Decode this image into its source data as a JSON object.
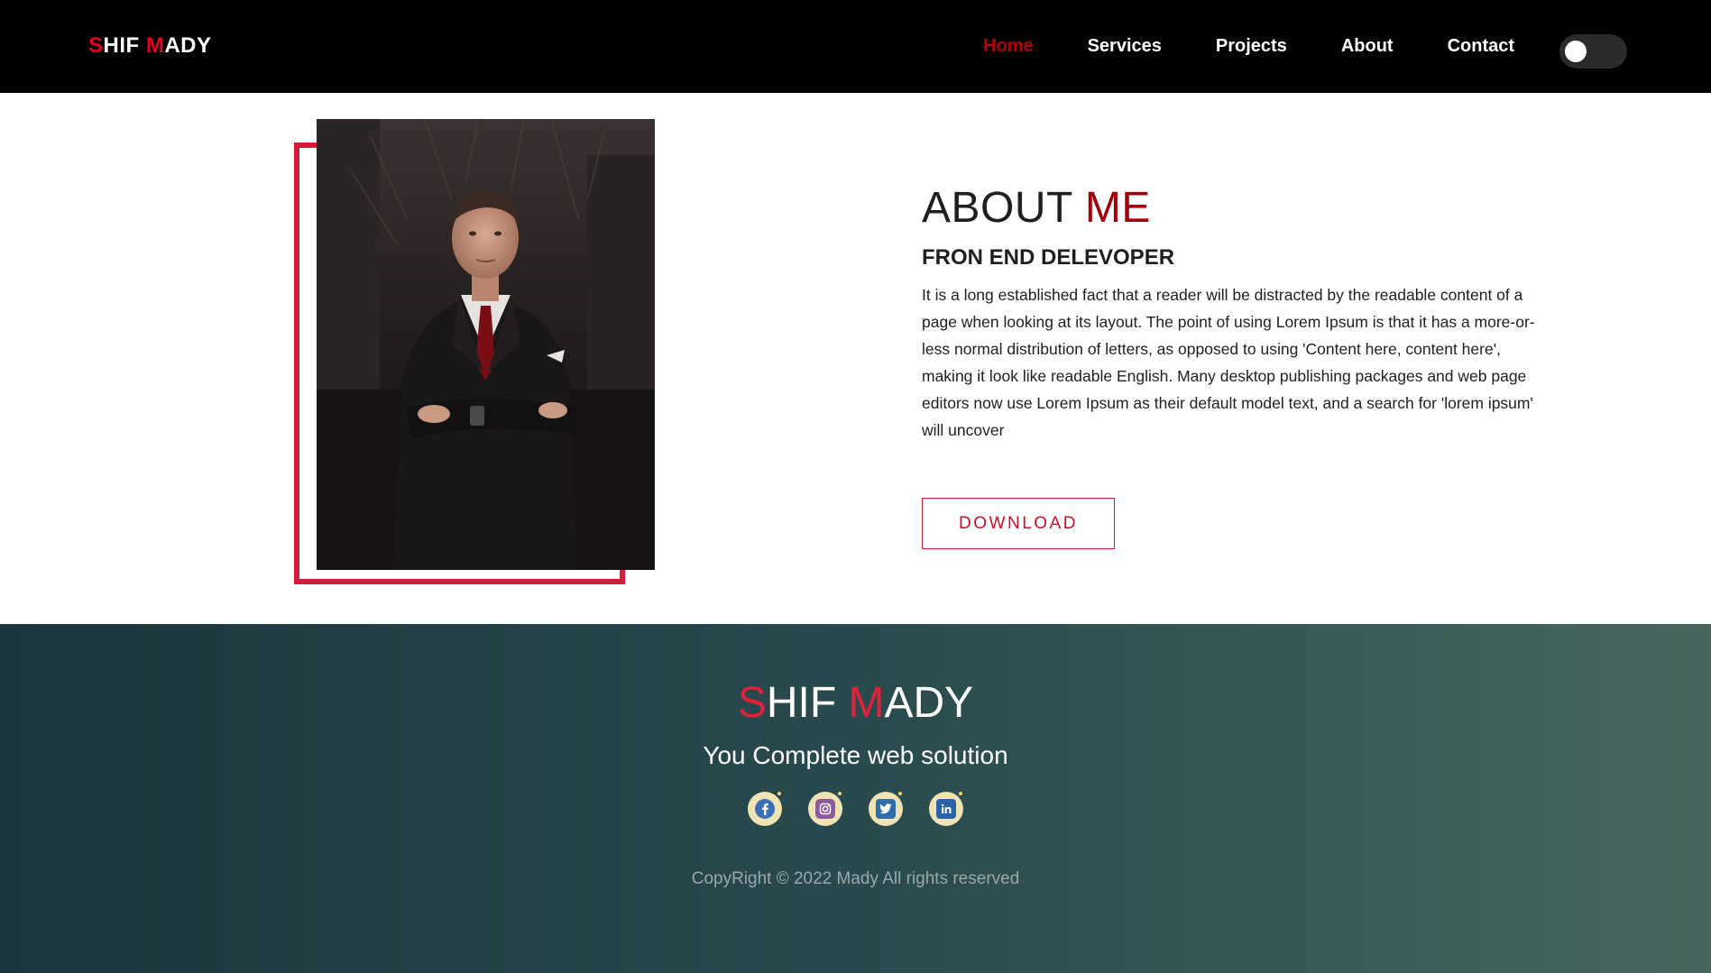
{
  "navbar": {
    "logo_first_initial": "S",
    "logo_first_rest": "HIF ",
    "logo_second_initial": "M",
    "logo_second_rest": "ADY",
    "links": [
      {
        "label": "Home",
        "active": true
      },
      {
        "label": "Services",
        "active": false
      },
      {
        "label": "Projects",
        "active": false
      },
      {
        "label": "About",
        "active": false
      },
      {
        "label": "Contact",
        "active": false
      }
    ],
    "theme_toggle_state": "off"
  },
  "about": {
    "title_main": "ABOUT ",
    "title_accent": "ME",
    "subtitle": "FRON END DELEVOPER",
    "description": "It is a long established fact that a reader will be distracted by the readable content of a page when looking at its layout. The point of using Lorem Ipsum is that it has a more-or-less normal distribution of letters, as opposed to using 'Content here, content here', making it look like readable English. Many desktop publishing packages and web page editors now use Lorem Ipsum as their default model text, and a search for 'lorem ipsum' will uncover",
    "download_label": "DOWNLOAD",
    "photo_alt": "man in dark suit with red tie, arms crossed"
  },
  "footer": {
    "logo_first_initial": "S",
    "logo_first_rest": "HIF ",
    "logo_second_initial": "M",
    "logo_second_rest": "ADY",
    "tagline": "You Complete web solution",
    "socials": [
      {
        "icon": "facebook-icon",
        "glyph": "f",
        "color": "#3b5998"
      },
      {
        "icon": "instagram-icon",
        "glyph": "◉",
        "color": "#8a3ab9"
      },
      {
        "icon": "twitter-icon",
        "glyph": "✦",
        "color": "#1da1f2"
      },
      {
        "icon": "linkedin-icon",
        "glyph": "in",
        "color": "#0a66c2"
      }
    ],
    "copyright": "CopyRight © 2022 Mady All rights reserved"
  },
  "colors": {
    "accent_red": "#e8001c",
    "dark_red": "#a3000b",
    "nav_bg": "#000000",
    "footer_gradient_start": "#1b363c",
    "footer_gradient_end": "#47675f"
  }
}
